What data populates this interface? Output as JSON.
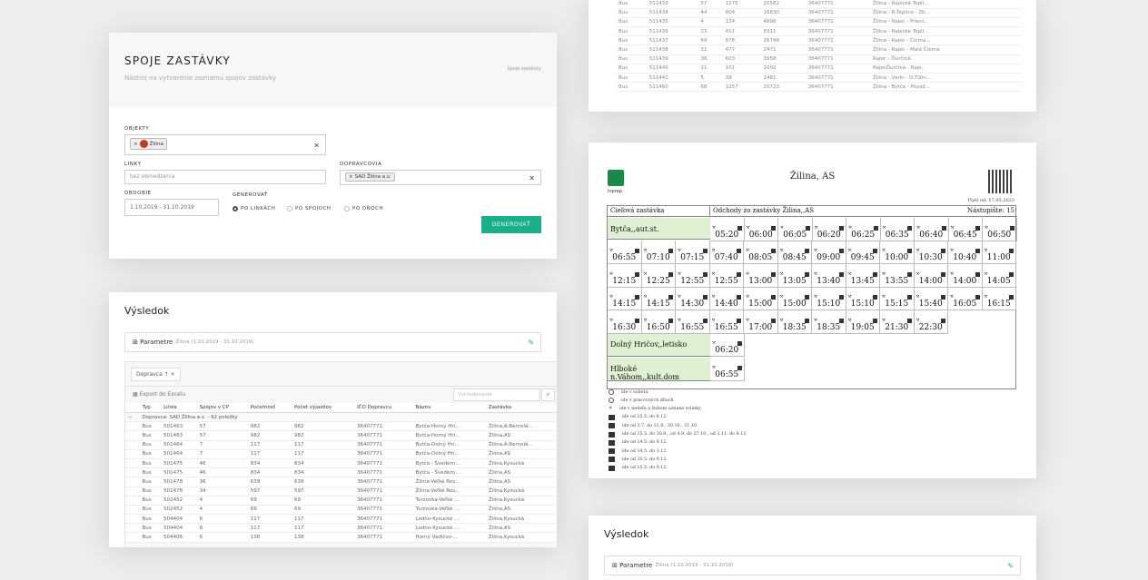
{
  "form": {
    "title": "SPOJE ZASTÁVKY",
    "subtitle": "Nástroj na vytvorenie zoznamu spojov zastávky",
    "breadcrumb": "Spoje zastávky",
    "objekty_label": "OBJEKTY",
    "objekty_chip": "Žilina",
    "linky_label": "LINKY",
    "linky_placeholder": "bez obmedzenia",
    "dopravcovia_label": "DOPRAVCOVIA",
    "dopravcovia_chip": "SAD Žilina a.s.",
    "obdobie_label": "OBDOBIE",
    "obdobie_value": "1.10.2019 - 31.10.2019",
    "generovat_label": "GENEROVAŤ",
    "radio_linky": "PO LINKÁCH",
    "radio_spojoch": "PO SPOJOCH",
    "radio_dnoch": "PO DŇOCH",
    "generate_button": "GENEROVAŤ",
    "clear": "×"
  },
  "result": {
    "title": "Výsledok",
    "params_label": "Parametre",
    "params_value": "Žilina (1.10.2019 - 31.10.2019)",
    "group_chip": "Dopravca ↑ ×",
    "export": "Export do Excelu",
    "search_placeholder": "Vyhľadávanie",
    "columns": [
      "Typ",
      "Linka",
      "Spojov v CP",
      "Početnosť",
      "Počet výjazdov",
      "IČO Dopravcu",
      "Názov",
      "Zastávka"
    ],
    "group_row": "Dopravca: SAD Žilina a.s. - 92 položky",
    "rows": [
      [
        "Bus",
        "501463",
        "57",
        "982",
        "982",
        "36407771",
        "Bytča-Horný Hri...",
        "Žilina,A.Bernolá..."
      ],
      [
        "Bus",
        "501463",
        "57",
        "982",
        "982",
        "36407771",
        "Bytča-Horný Hri...",
        "Žilina,AS"
      ],
      [
        "Bus",
        "501464",
        "7",
        "117",
        "117",
        "36407771",
        "Bytča-Dolný Hri...",
        "Žilina,A.Bernolá..."
      ],
      [
        "Bus",
        "501464",
        "7",
        "117",
        "117",
        "36407771",
        "Bytča-Dolný Hri...",
        "Žilina,AS"
      ],
      [
        "Bus",
        "501475",
        "46",
        "834",
        "834",
        "36407771",
        "Bytča - Švedern...",
        "Žilina,Kysucká"
      ],
      [
        "Bus",
        "501475",
        "46",
        "834",
        "834",
        "36407771",
        "Bytča - Švedern...",
        "Žilina,AS"
      ],
      [
        "Bus",
        "501478",
        "36",
        "639",
        "639",
        "36407771",
        "Žilina-Veľké Rov...",
        "Žilina,AS"
      ],
      [
        "Bus",
        "501478",
        "34",
        "597",
        "597",
        "36407771",
        "Žilina-Veľké Rov...",
        "Žilina,Kysucká"
      ],
      [
        "Bus",
        "502452",
        "4",
        "69",
        "69",
        "36407771",
        "Turzovka-Veľké ...",
        "Žilina,Kysucká"
      ],
      [
        "Bus",
        "502452",
        "4",
        "69",
        "69",
        "36407771",
        "Turzovka-Veľké ...",
        "Žilina,AS"
      ],
      [
        "Bus",
        "504404",
        "6",
        "117",
        "117",
        "36407771",
        "Lodno-Kysucké ...",
        "Žilina,Kysucká"
      ],
      [
        "Bus",
        "504404",
        "6",
        "117",
        "117",
        "36407771",
        "Lodno-Kysucké ...",
        "Žilina,AS"
      ],
      [
        "Bus",
        "504406",
        "6",
        "138",
        "138",
        "36407771",
        "Horný Vadičov-...",
        "Žilina,Kysucká"
      ]
    ]
  },
  "top_table": {
    "rows": [
      [
        "Bus",
        "511433",
        "57",
        "1175",
        "20582",
        "36407771",
        "Žilina - Rajecké Tepli..."
      ],
      [
        "Bus",
        "511434",
        "44",
        "804",
        "16830",
        "36407771",
        "Žilina - R.Teplice - Zb..."
      ],
      [
        "Bus",
        "511435",
        "4",
        "124",
        "4898",
        "36407771",
        "Žilina - Rajec - Prievi..."
      ],
      [
        "Bus",
        "511436",
        "23",
        "411",
        "6311",
        "36407771",
        "Žilina - Rajecké Tepli..."
      ],
      [
        "Bus",
        "511437",
        "64",
        "876",
        "26748",
        "36407771",
        "Žilina - Rajec - Čičma..."
      ],
      [
        "Bus",
        "511438",
        "31",
        "477",
        "2471",
        "36407771",
        "Žilina - Rajec - Malá Čierna"
      ],
      [
        "Bus",
        "511439",
        "38",
        "603",
        "3958",
        "36407771",
        "Rajec - Ďurčiná"
      ],
      [
        "Bus",
        "511440",
        "11",
        "101",
        "1002",
        "36407771",
        "RajecĎurčiná - Raje..."
      ],
      [
        "Bus",
        "511441",
        "5",
        "39",
        "1481",
        "36407771",
        "Žilina - Varín - O.Tížin..."
      ],
      [
        "Bus",
        "511460",
        "68",
        "1257",
        "20723",
        "36407771",
        "Žilina - Bytča - Považ..."
      ]
    ]
  },
  "timetable": {
    "brand": "inprep",
    "title": "Žilina, AS",
    "valid": "Platí od: 17.05.2023",
    "col_target": "Cieľová zastávka",
    "col_departures": "Odchody zo zastávky Žilina,,AS",
    "platform": "Nástupište: 15",
    "stops": [
      "Bytča,,aut.st.",
      "Dolný Hričov,,letisko",
      "Hlboké n.Váhom,,kult.dom"
    ],
    "times": [
      [
        "05:20",
        "06:00",
        "06:05",
        "06:20",
        "06:25",
        "06:35",
        "06:40",
        "06:45",
        "06:50"
      ],
      [
        "06:55",
        "07:10",
        "07:15",
        "07:40",
        "08:05",
        "08:45",
        "09:00",
        "09:45",
        "10:00",
        "10:30",
        "10:40",
        "11:00"
      ],
      [
        "12:15",
        "12:25",
        "12:55",
        "12:55",
        "13:00",
        "13:05",
        "13:40",
        "13:45",
        "13:55",
        "14:00",
        "14:00",
        "14:05"
      ],
      [
        "14:15",
        "14:15",
        "14:30",
        "14:40",
        "15:00",
        "15:00",
        "15:10",
        "15:10",
        "15:15",
        "15:40",
        "16:05",
        "16:15"
      ],
      [
        "16:30",
        "16:50",
        "16:55",
        "16:55",
        "17:00",
        "18:35",
        "18:35",
        "19:05",
        "21:30",
        "22:30"
      ]
    ],
    "times_hricov": [
      "06:20"
    ],
    "times_hlboke": [
      "06:55"
    ],
    "legend": [
      {
        "kind": "circle",
        "text": "ide v sobotu"
      },
      {
        "kind": "circle",
        "text": "ide v pracovných dňoch"
      },
      {
        "kind": "cross",
        "text": "ide v nedeľu a štátom uznané sviatky"
      },
      {
        "kind": "sq",
        "text": "ide od 15.5. do 8.12."
      },
      {
        "kind": "sq",
        "text": "ide od 3.7. do 31.8., 30.10., 31.10."
      },
      {
        "kind": "sq",
        "text": "ide od 15.5. do 30.6., od 4.9. do 27.10., od 2.11. do 8.12."
      },
      {
        "kind": "sq",
        "text": "ide od 14.5. do 9.12."
      },
      {
        "kind": "sq",
        "text": "ide od 14.5. do 3.12."
      },
      {
        "kind": "sq",
        "text": "ide od 20.5. do 9.12."
      },
      {
        "kind": "sq",
        "text": "ide od 15.5. do 9.12."
      }
    ]
  },
  "result2": {
    "title": "Výsledok",
    "params_label": "Parametre",
    "params_value": "Žilina (1.10.2019 - 31.10.2019)"
  }
}
